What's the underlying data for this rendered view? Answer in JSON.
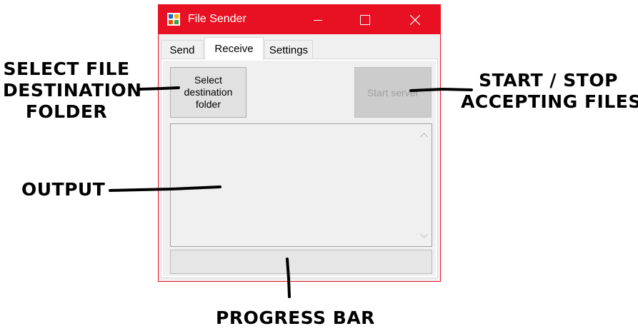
{
  "window": {
    "title": "File Sender",
    "accent_color": "#e81123",
    "icons": {
      "app": "app-icon",
      "minimize": "minimize-icon",
      "maximize": "maximize-icon",
      "close": "close-icon"
    }
  },
  "tabs": [
    {
      "label": "Send",
      "selected": false
    },
    {
      "label": "Receive",
      "selected": true
    },
    {
      "label": "Settings",
      "selected": false
    }
  ],
  "receive_panel": {
    "select_folder_button": {
      "line1": "Select",
      "line2": "destination",
      "line3": "folder"
    },
    "start_server_button": {
      "label": "Start server",
      "enabled": false
    },
    "output": {
      "text": ""
    },
    "progress": {
      "value": 0
    }
  },
  "annotations": {
    "select_folder": {
      "line1": "SELECT FILE",
      "line2": "DESTINATION",
      "line3": "FOLDER"
    },
    "start_stop": {
      "line1": "START / STOP",
      "line2": "ACCEPTING FILES"
    },
    "output": "OUTPUT",
    "progress": "PROGRESS BAR"
  }
}
